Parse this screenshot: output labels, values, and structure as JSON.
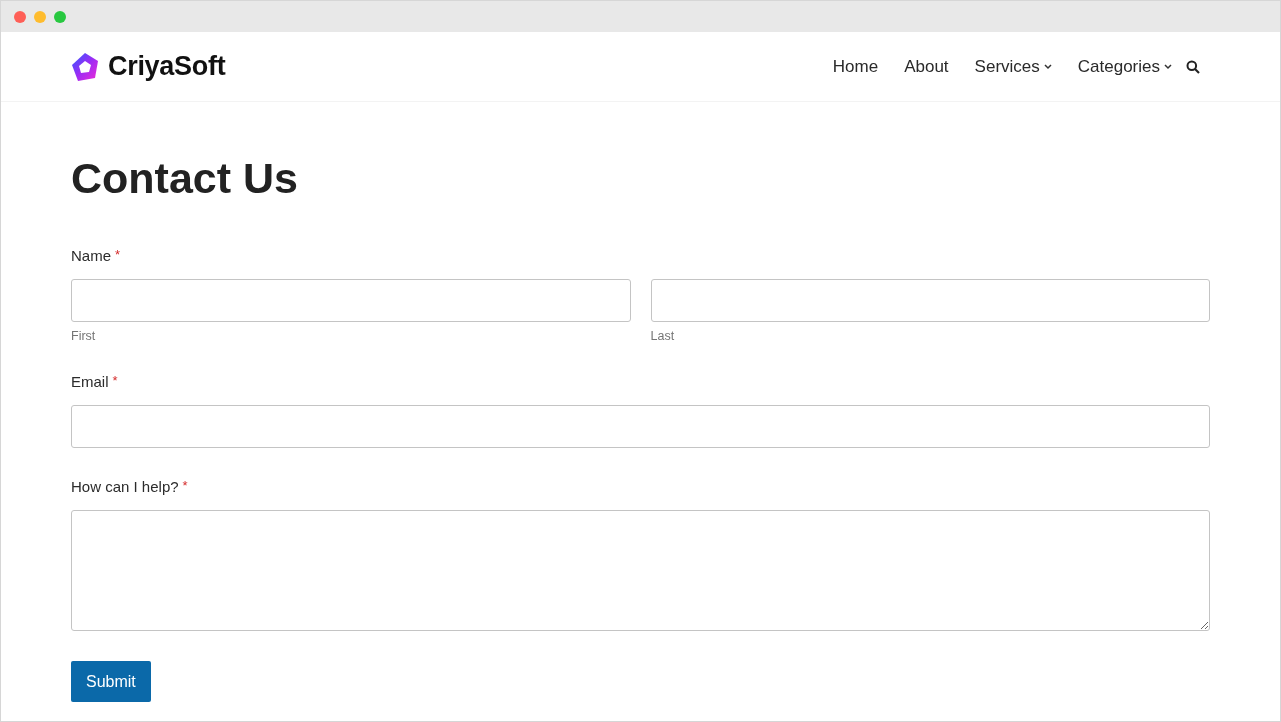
{
  "brand": {
    "name": "CriyaSoft"
  },
  "nav": [
    {
      "label": "Home",
      "has_dropdown": false
    },
    {
      "label": "About",
      "has_dropdown": false
    },
    {
      "label": "Services",
      "has_dropdown": true
    },
    {
      "label": "Categories",
      "has_dropdown": true
    }
  ],
  "page_title": "Contact Us",
  "form": {
    "fields": [
      {
        "kind": "name",
        "label": "Name",
        "required_mark": "*",
        "parts": [
          {
            "sublabel": "First"
          },
          {
            "sublabel": "Last"
          }
        ]
      },
      {
        "kind": "text",
        "label": "Email",
        "required_mark": "*"
      },
      {
        "kind": "textarea",
        "label": "How can I help?",
        "required_mark": "*"
      }
    ],
    "submit": "Submit"
  }
}
